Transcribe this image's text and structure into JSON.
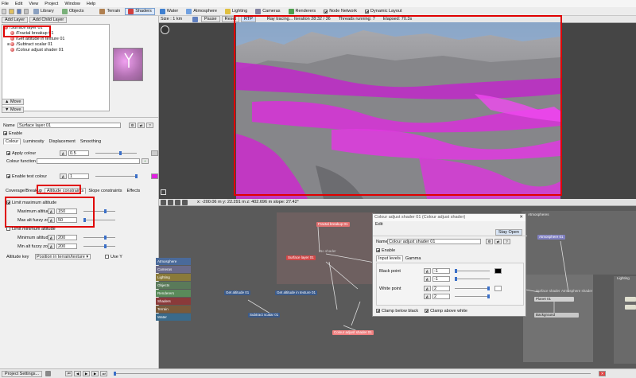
{
  "menu": [
    "File",
    "Edit",
    "View",
    "Project",
    "Window",
    "Help"
  ],
  "toolbar": {
    "items": [
      {
        "label": "Library",
        "color": "#8aa0c0"
      },
      {
        "label": "Objects",
        "color": "#7ab07a"
      },
      {
        "label": "Terrain",
        "color": "#b08050"
      },
      {
        "label": "Shaders",
        "color": "#d04040",
        "active": true
      },
      {
        "label": "Water",
        "color": "#4080d0"
      },
      {
        "label": "Atmosphere",
        "color": "#70a0e0"
      },
      {
        "label": "Lighting",
        "color": "#e0c040"
      },
      {
        "label": "Cameras",
        "color": "#8080a0"
      },
      {
        "label": "Renderers",
        "color": "#50a050"
      },
      {
        "label": "Node Network",
        "color": "#a060a0"
      },
      {
        "label": "Dynamic Layout",
        "color": "#606060"
      }
    ]
  },
  "left_panel": {
    "add_layer": "Add Layer",
    "add_child_layer": "Add Child Layer",
    "tree": [
      "/Surface layer 01",
      "/Fractal breakup 01",
      "/Get altitude in texture 01",
      "/Subtract scalar 01",
      "/Colour adjust shader 01"
    ],
    "move_up": "Move",
    "move_down": "Move",
    "name_label": "Name",
    "name_value": "Surface layer 01",
    "enable_label": "Enable",
    "tabs1": [
      "Colour",
      "Luminosity",
      "Displacement",
      "Smoothing"
    ],
    "apply_colour": "Apply colour",
    "apply_colour_value": "0.5",
    "colour_function": "Colour function",
    "enable_test_colour": "Enable test colour",
    "test_colour_value": "1",
    "test_colour": "#e020e0",
    "tabs2": [
      "Coverage/Breakup",
      "Altitude constraints",
      "Slope constraints",
      "Effects"
    ],
    "limit_max_altitude": "Limit maximum altitude",
    "max_altitude": "Maximum altitude",
    "max_altitude_value": "150",
    "max_fuzzy": "Max alt fuzzy zone",
    "max_fuzzy_value": "50",
    "limit_min_altitude": "Limit minimum altitude",
    "min_altitude": "Minimum altitude",
    "min_altitude_value": "200",
    "min_fuzzy": "Min alt fuzzy zone",
    "min_fuzzy_value": "200",
    "altitude_key": "Altitude key",
    "altitude_key_value": "Position in terrain/texture",
    "use_y": "Use Y"
  },
  "viewport": {
    "size": "Size : 1 km",
    "pause": "Pause",
    "reset": "Reset",
    "rtp": "RTP",
    "status": "Ray tracing... Iteration 28:32 / 36",
    "threads": "Threads running: 7",
    "elapsed": "Elapsed: 70.3s",
    "coords": "x: -200.06 m    y: 22.291 m    z: 402.696 m    slope: 27.42°"
  },
  "nodes": {
    "categories": [
      {
        "label": "Atmosphere",
        "color": "#4a6a9a"
      },
      {
        "label": "Cameras",
        "color": "#6a6a8a"
      },
      {
        "label": "Lighting",
        "color": "#8a7a3a"
      },
      {
        "label": "Objects",
        "color": "#5a7a5a"
      },
      {
        "label": "Renderers",
        "color": "#5a8a5a"
      },
      {
        "label": "Shaders",
        "color": "#8a3a3a"
      },
      {
        "label": "Terrain",
        "color": "#7a5a3a"
      },
      {
        "label": "Water",
        "color": "#3a6a8a"
      }
    ],
    "fractal": "Fractal breakup 01",
    "surface": "Surface layer 01",
    "no_shader": "No shader",
    "get_alt": "Get altitude 01",
    "get_alt_tex": "Get altitude in texture 01",
    "subtract": "Subtract scalar 01",
    "colour_adjust": "Colour adjust shader 01",
    "atmosphere": "Atmosphere 01",
    "atmospheres": "Atmospheres",
    "planet": "Planet 01",
    "background": "Background",
    "lighting": "Lighting",
    "surface_shader": "Surface shader",
    "atmosphere_shader": "Atmosphere shader"
  },
  "dialog": {
    "title": "Colour adjust shader 01   (Colour adjust shader)",
    "edit": "Edit",
    "stay_open": "Stay Open",
    "name_label": "Name",
    "name_value": "Colour adjust shader 01",
    "enable": "Enable",
    "tabs": [
      "Input levels",
      "Gamma"
    ],
    "black_point": "Black point",
    "bp_value1": "-1",
    "bp_value2": "-1",
    "white_point": "White point",
    "wp_value1": "2",
    "wp_value2": "2",
    "clamp_below": "Clamp below black",
    "clamp_above": "Clamp above white"
  },
  "statusbar": {
    "project_settings": "Project Settings..."
  }
}
